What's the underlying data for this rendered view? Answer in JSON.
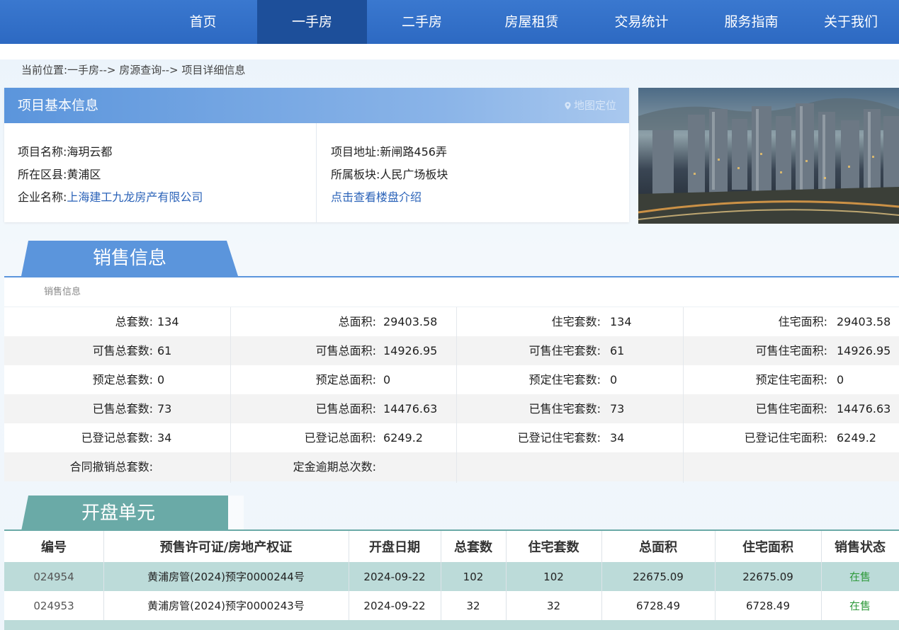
{
  "nav": {
    "items": [
      {
        "label": "首页"
      },
      {
        "label": "一手房"
      },
      {
        "label": "二手房"
      },
      {
        "label": "房屋租赁"
      },
      {
        "label": "交易统计"
      },
      {
        "label": "服务指南"
      },
      {
        "label": "关于我们"
      }
    ],
    "active_index": 1,
    "bg_color": "#2d69c2",
    "active_color": "#1d4f9a"
  },
  "breadcrumb": "当前位置:一手房--> 房源查询--> 项目详细信息",
  "basic_info": {
    "title": "项目基本信息",
    "map_link": "地图定位",
    "project_name_label": "项目名称:",
    "project_name": "海玥云都",
    "district_label": "所在区县:",
    "district": "黄浦区",
    "company_label": "企业名称:",
    "company": "上海建工九龙房产有限公司",
    "address_label": "项目地址:",
    "address": "新闸路456弄",
    "block_label": "所属板块:",
    "block": "人民广场板块",
    "intro_link": "点击查看楼盘介绍"
  },
  "sales": {
    "tab_title": "销售信息",
    "caption": "销售信息",
    "rows": [
      [
        [
          "总套数:",
          "134"
        ],
        [
          "总面积:",
          "29403.58"
        ],
        [
          "住宅套数:",
          "134"
        ],
        [
          "住宅面积:",
          "29403.58"
        ]
      ],
      [
        [
          "可售总套数:",
          "61"
        ],
        [
          "可售总面积:",
          "14926.95"
        ],
        [
          "可售住宅套数:",
          "61"
        ],
        [
          "可售住宅面积:",
          "14926.95"
        ]
      ],
      [
        [
          "预定总套数:",
          "0"
        ],
        [
          "预定总面积:",
          "0"
        ],
        [
          "预定住宅套数:",
          "0"
        ],
        [
          "预定住宅面积:",
          "0"
        ]
      ],
      [
        [
          "已售总套数:",
          "73"
        ],
        [
          "已售总面积:",
          "14476.63"
        ],
        [
          "已售住宅套数:",
          "73"
        ],
        [
          "已售住宅面积:",
          "14476.63"
        ]
      ],
      [
        [
          "已登记总套数:",
          "34"
        ],
        [
          "已登记总面积:",
          "6249.2"
        ],
        [
          "已登记住宅套数:",
          "34"
        ],
        [
          "已登记住宅面积:",
          "6249.2"
        ]
      ],
      [
        [
          "合同撤销总套数:",
          ""
        ],
        [
          "定金逾期总次数:",
          ""
        ],
        [
          "",
          ""
        ],
        [
          "",
          ""
        ]
      ]
    ]
  },
  "units": {
    "tab_title": "开盘单元",
    "headers": [
      "编号",
      "预售许可证/房地产权证",
      "开盘日期",
      "总套数",
      "住宅套数",
      "总面积",
      "住宅面积",
      "销售状态"
    ],
    "rows": [
      [
        "024954",
        "黄浦房管(2024)预字0000244号",
        "2024-09-22",
        "102",
        "102",
        "22675.09",
        "22675.09",
        "在售"
      ],
      [
        "024953",
        "黄浦房管(2024)预字0000243号",
        "2024-09-22",
        "32",
        "32",
        "6728.49",
        "6728.49",
        "在售"
      ]
    ],
    "status_color": "#2f9a3c"
  }
}
